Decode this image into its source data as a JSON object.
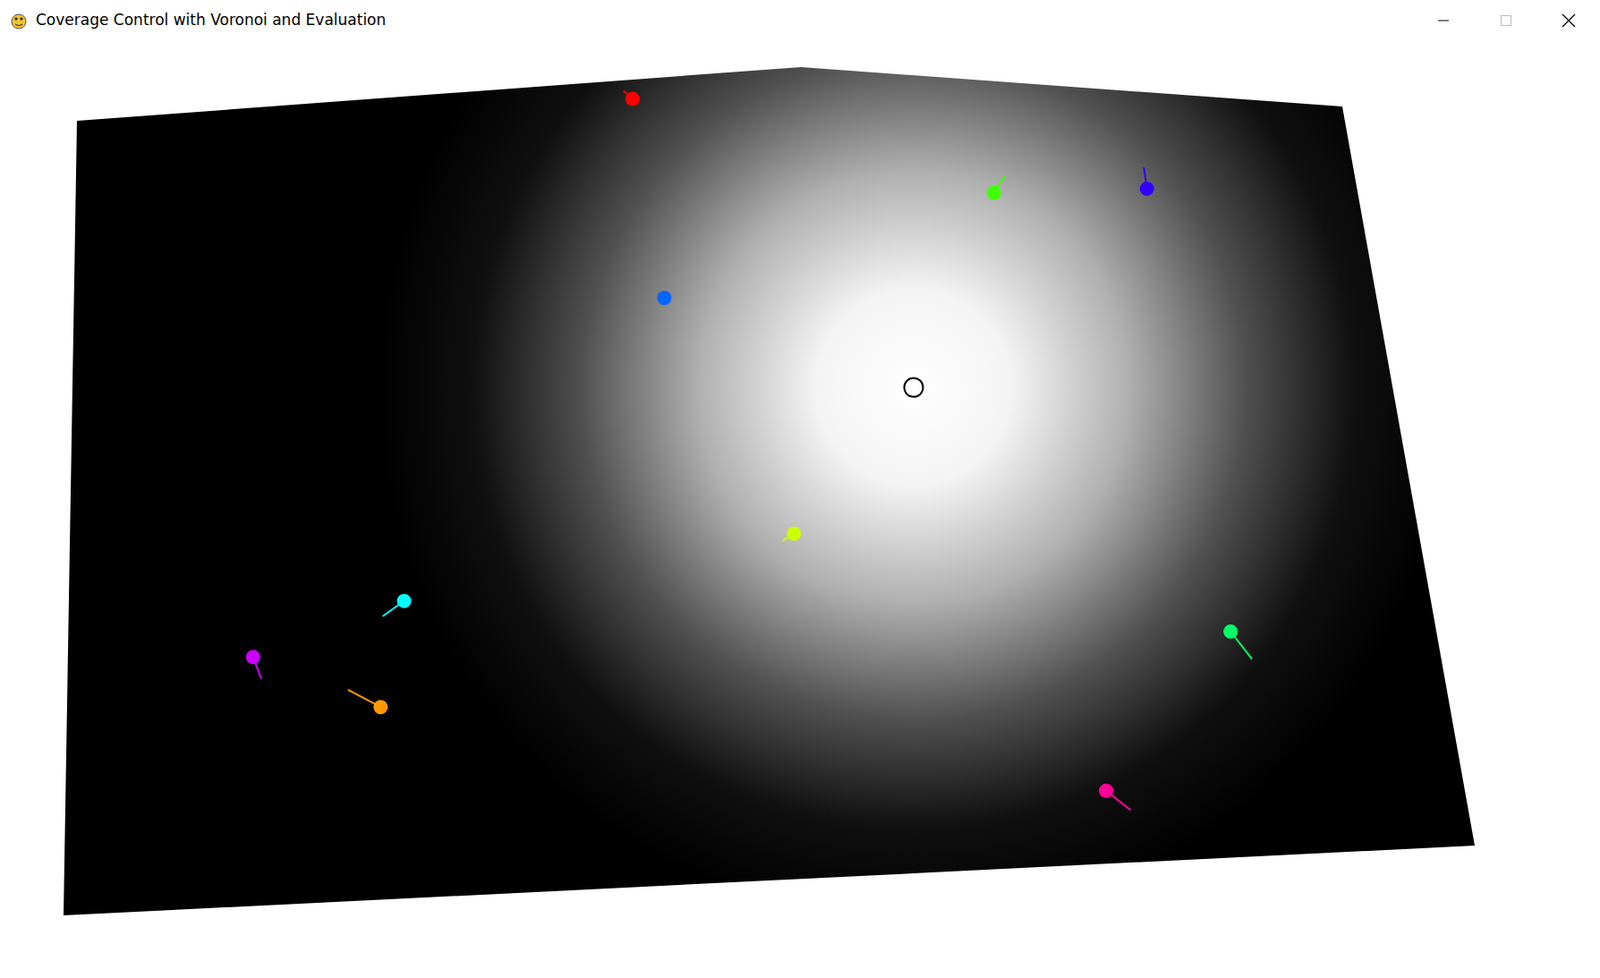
{
  "window": {
    "title": "Coverage Control with Voronoi and Evaluation"
  },
  "robots": [
    {
      "color": "#ff0000"
    },
    {
      "color": "#40ff00"
    },
    {
      "color": "#3300ff"
    },
    {
      "color": "#0066ff"
    },
    {
      "color": "#ccff00"
    },
    {
      "color": "#00ffff"
    },
    {
      "color": "#cc00ff"
    },
    {
      "color": "#ff9900"
    },
    {
      "color": "#00ff66"
    },
    {
      "color": "#ff0099"
    }
  ]
}
